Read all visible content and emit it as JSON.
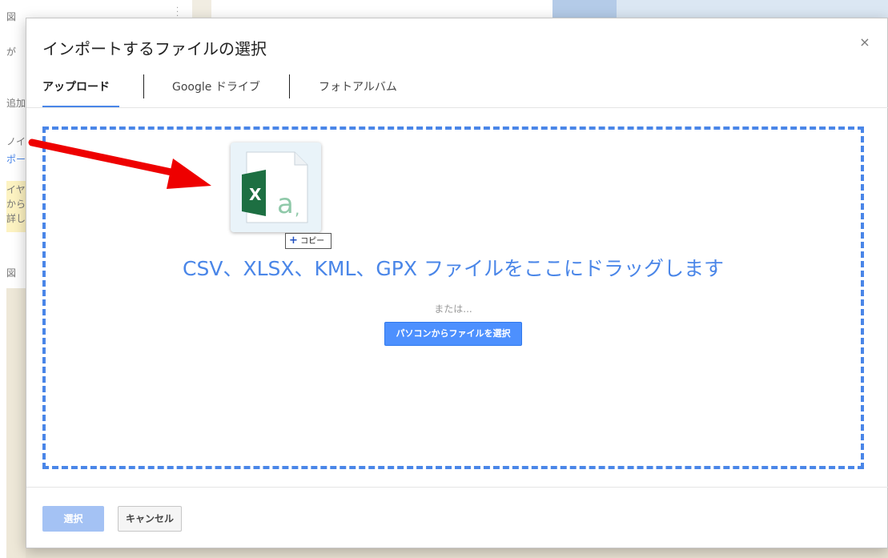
{
  "background": {
    "left_texts": [
      "図",
      "が",
      "追加",
      "ノイ",
      "ポー",
      "イヤ",
      "から",
      "詳し",
      "図"
    ]
  },
  "dialog": {
    "title": "インポートするファイルの選択",
    "close_glyph": "×",
    "tabs": [
      {
        "label": "アップロード",
        "active": true
      },
      {
        "label": "Google ドライブ",
        "active": false
      },
      {
        "label": "フォトアルバム",
        "active": false
      }
    ],
    "dropzone": {
      "drop_text": "CSV、XLSX、KML、GPX ファイルをここにドラッグします",
      "or_text": "または...",
      "pick_button": "パソコンからファイルを選択"
    },
    "drag_preview": {
      "icon": "excel-file-icon",
      "copy_plus": "+",
      "copy_label": "コピー"
    },
    "footer": {
      "select_label": "選択",
      "cancel_label": "キャンセル"
    }
  },
  "colors": {
    "accent": "#4a86e8",
    "primary_button": "#4d90fe",
    "disabled_button": "#a4c2f4",
    "arrow": "#ee0000",
    "excel_green": "#1d6f42"
  }
}
